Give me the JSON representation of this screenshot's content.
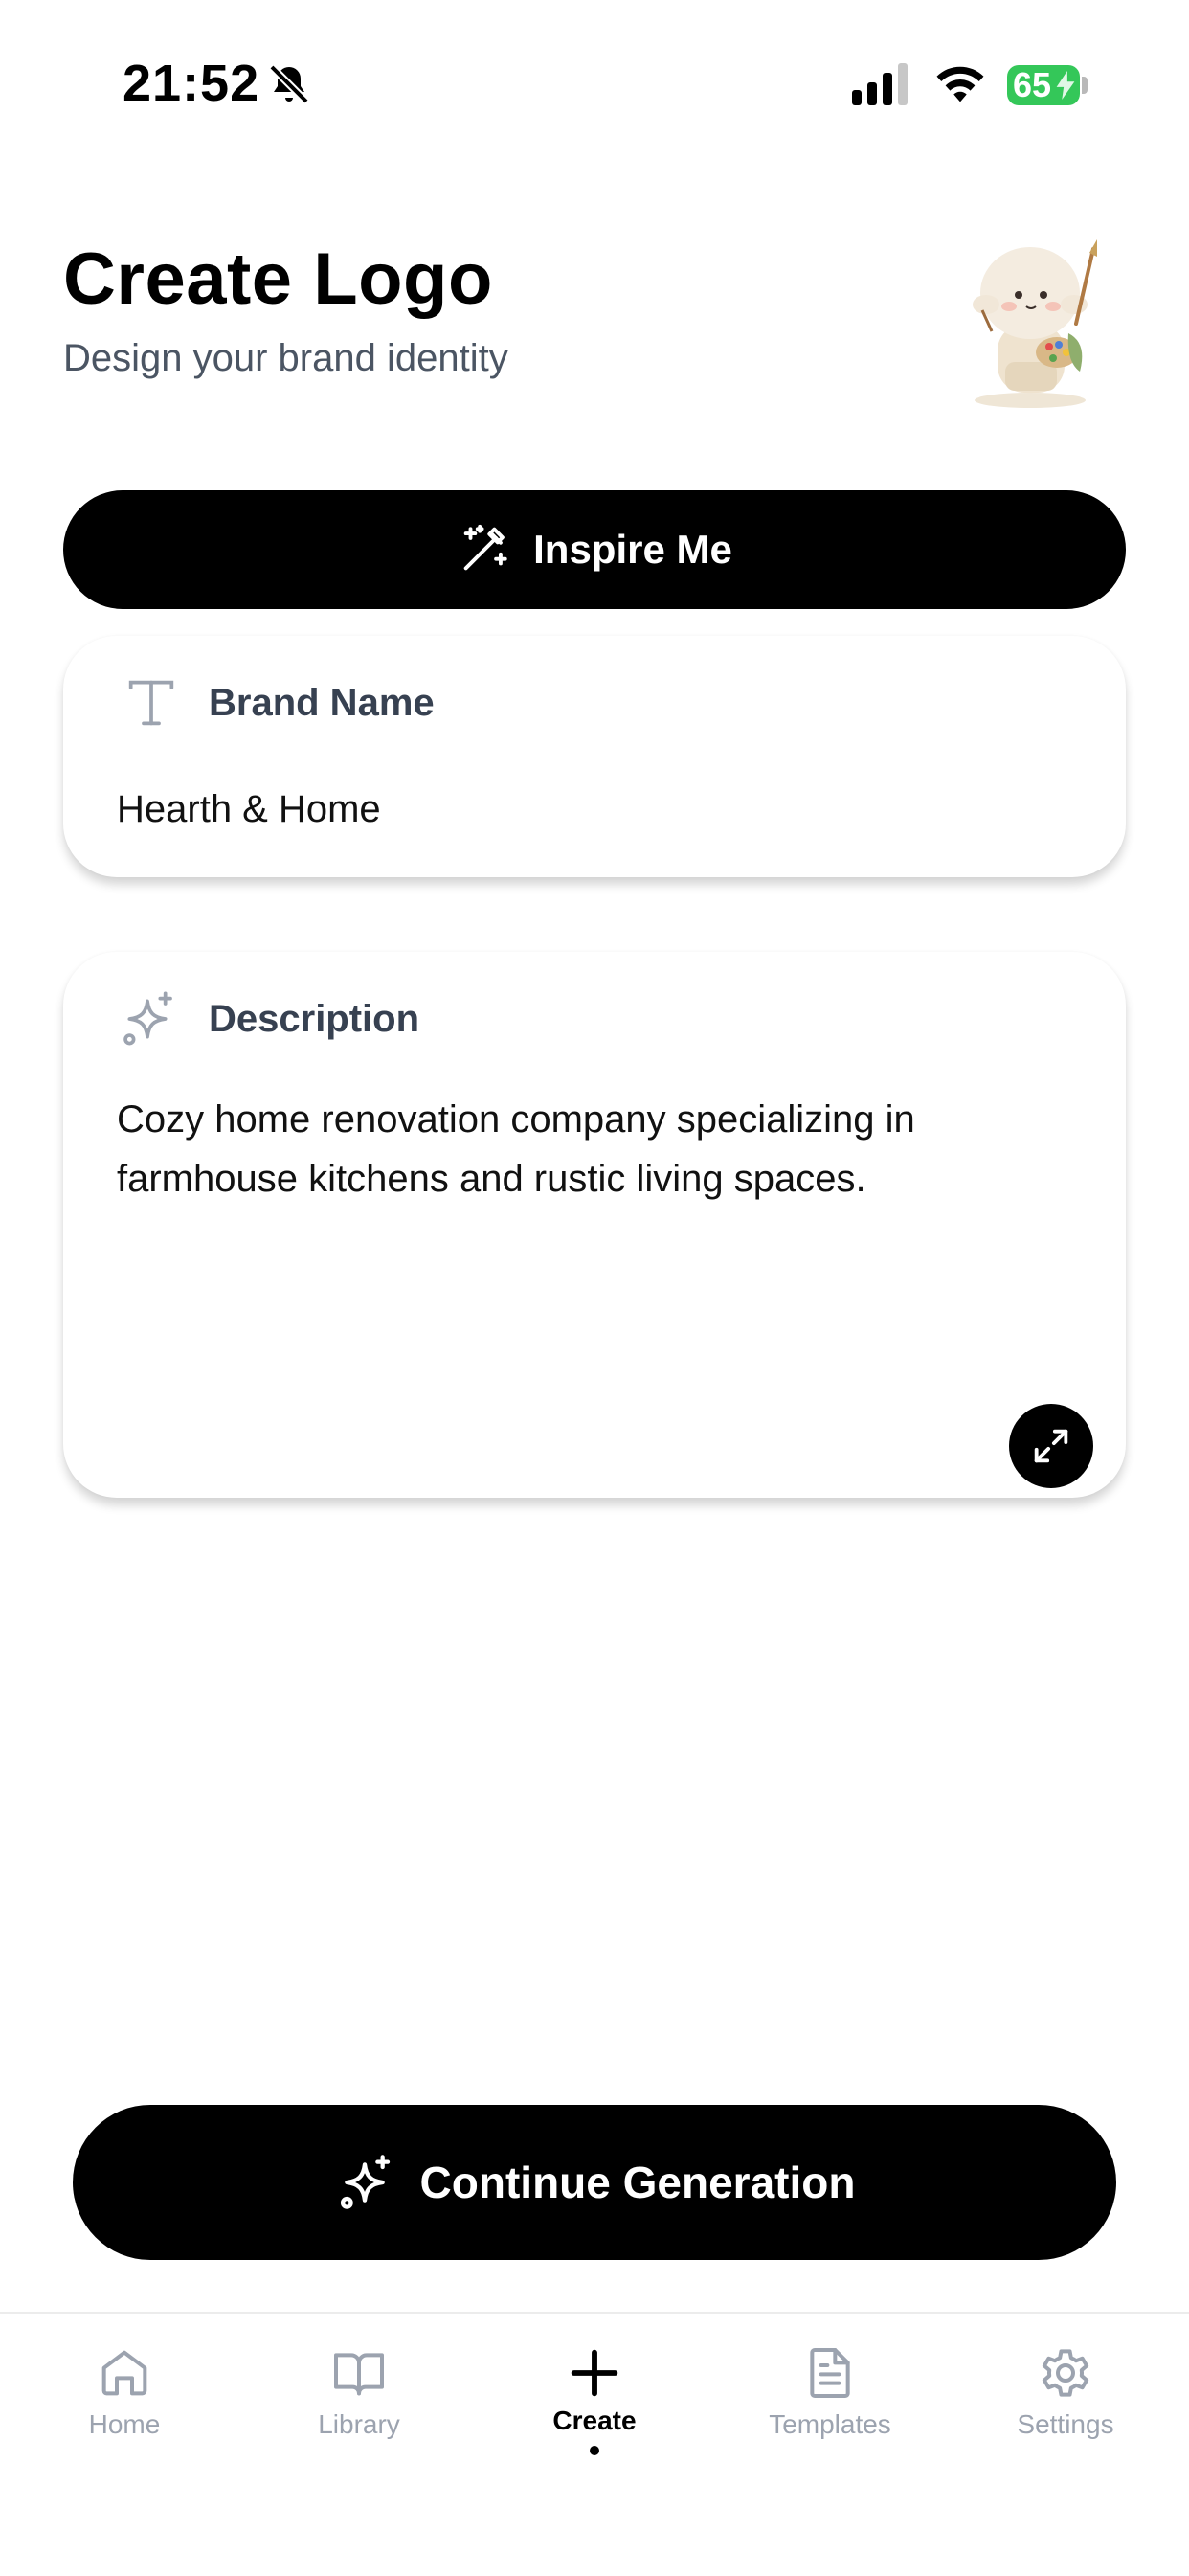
{
  "status_bar": {
    "time": "21:52",
    "battery": "65"
  },
  "header": {
    "title": "Create Logo",
    "subtitle": "Design your brand identity"
  },
  "inspire_button": {
    "label": "Inspire Me"
  },
  "brand_card": {
    "label": "Brand Name",
    "value": "Hearth & Home"
  },
  "description_card": {
    "label": "Description",
    "value": "Cozy home renovation company specializing in farmhouse kitchens and rustic living spaces."
  },
  "continue_button": {
    "label": "Continue Generation"
  },
  "tab_bar": {
    "tabs": [
      {
        "label": "Home",
        "icon": "home-icon",
        "active": false
      },
      {
        "label": "Library",
        "icon": "book-icon",
        "active": false
      },
      {
        "label": "Create",
        "icon": "plus-icon",
        "active": true
      },
      {
        "label": "Templates",
        "icon": "document-icon",
        "active": false
      },
      {
        "label": "Settings",
        "icon": "gear-icon",
        "active": false
      }
    ]
  },
  "colors": {
    "accent": "#000000",
    "battery": "#34c759",
    "muted": "#9ca3af",
    "subtitle": "#4b5563"
  }
}
